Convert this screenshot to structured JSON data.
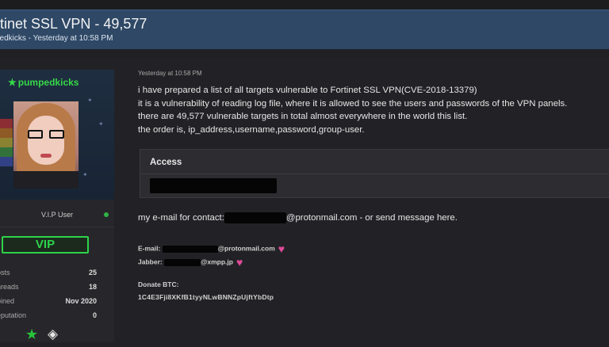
{
  "thread": {
    "title": "rtinet SSL VPN - 49,577",
    "subtitle": "pedkicks - Yesterday at 10:58 PM"
  },
  "user": {
    "username": "pumpedkicks",
    "role": "V.I.P User",
    "badge": "VIP",
    "stats": [
      {
        "label": "osts",
        "value": "25"
      },
      {
        "label": "hreads",
        "value": "18"
      },
      {
        "label": "oined",
        "value": "Nov 2020"
      },
      {
        "label": "eputation",
        "value": "0"
      }
    ],
    "awards": [
      "star-icon",
      "diamond-icon"
    ]
  },
  "post": {
    "date": "Yesterday at 10:58 PM",
    "lines": [
      "i have prepared a list of all targets vulnerable to Fortinet SSL VPN(CVE-2018-13379)",
      "it is a vulnerability of reading log file, where it is allowed to see the users and passwords of the VPN panels.",
      "there are 49,577 vulnerable targets in total almost everywhere in the world this list.",
      "the order is, ip_address,username,password,group-user."
    ],
    "access_title": "Access",
    "contact_prefix": "my e-mail for contact:",
    "contact_suffix": "@protonmail.com - or send message here.",
    "email_label": "E-mail:",
    "email_suffix": "@protonmail.com",
    "jabber_label": "Jabber:",
    "jabber_suffix": "@xmpp.jp",
    "btc_label": "Donate BTC:",
    "btc_address": "1C4E3Fji8XKfB1tyyNLwBNNZpUjftYbDtp"
  },
  "colors": {
    "header_bg": "#2e4866",
    "username": "#37d74a",
    "vip": "#2ed34a",
    "heart": "#e04a9a"
  }
}
